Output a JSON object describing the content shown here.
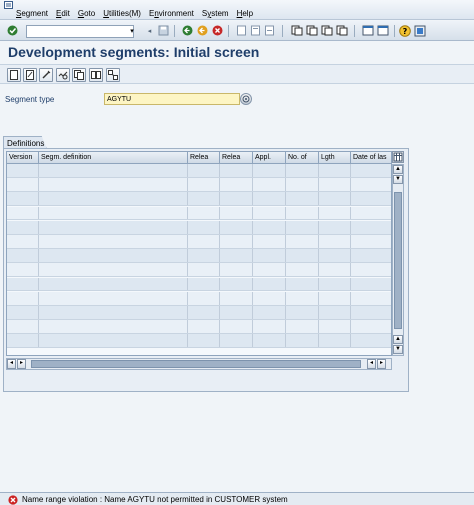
{
  "menubar": {
    "items": [
      {
        "label": "Segment",
        "accel": "S"
      },
      {
        "label": "Edit",
        "accel": "E"
      },
      {
        "label": "Goto",
        "accel": "G"
      },
      {
        "label": "Utilities(M)",
        "accel": "U"
      },
      {
        "label": "Environment",
        "accel": "n"
      },
      {
        "label": "System",
        "accel": "y"
      },
      {
        "label": "Help",
        "accel": "H"
      }
    ]
  },
  "toolbar": {
    "command_field_value": "",
    "icons": [
      "enter-icon",
      "save-icon",
      "back-icon",
      "exit-icon",
      "cancel-icon",
      "print-icon",
      "find-icon",
      "find-next-icon",
      "first-page-icon",
      "previous-page-icon",
      "next-page-icon",
      "last-page-icon",
      "new-session-icon",
      "shortcut-icon",
      "help-icon",
      "customize-layout-icon"
    ]
  },
  "page": {
    "title": "Development segments: Initial screen"
  },
  "app_toolbar": {
    "icons": [
      "create-icon",
      "change-icon",
      "display-icon",
      "check-icon",
      "copy-icon",
      "other-object-icon",
      "where-used-icon"
    ]
  },
  "segment_type": {
    "label": "Segment type",
    "value": "AGYTU"
  },
  "definitions": {
    "tab_label": "Definitions",
    "columns": [
      "Version",
      "Segm. definition",
      "Relea",
      "Relea",
      "Appl.",
      "No. of",
      "Lgth",
      "Date of las"
    ],
    "rows": [
      [],
      [],
      [],
      [],
      [],
      [],
      [],
      [],
      [],
      [],
      [],
      [],
      []
    ]
  },
  "status": {
    "type": "error",
    "message": "Name range violation : Name AGYTU not permitted in CUSTOMER system"
  },
  "colors": {
    "title": "#1f3e6a",
    "required_field": "#fdf5c4",
    "error": "#cc2222"
  }
}
